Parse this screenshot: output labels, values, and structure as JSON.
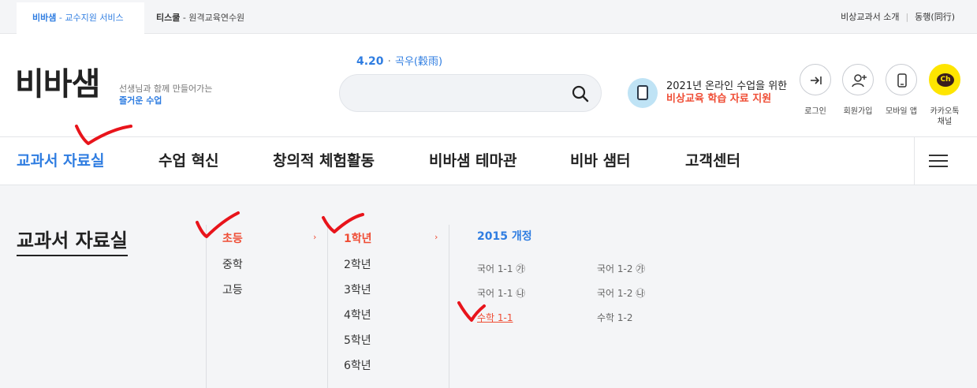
{
  "topbar": {
    "site_tabs": [
      {
        "name": "비바샘",
        "sub": "- 교수지원 서비스"
      },
      {
        "name": "티스쿨",
        "sub": "- 원격교육연수원"
      }
    ],
    "links": [
      "비상교과서 소개",
      "동행(同行)"
    ]
  },
  "header": {
    "logo": "비바샘",
    "tagline_line1": "선생님과 함께 만들어가는",
    "tagline_line2": "즐거운 수업",
    "date": "4.20",
    "solar_term": "곡우(穀雨)",
    "search_value": "",
    "promo_line1": "2021년 온라인 수업을 위한",
    "promo_line2": "비상교육 학습 자료 지원"
  },
  "utility": [
    {
      "label": "로그인",
      "icon": "login-icon"
    },
    {
      "label": "회원가입",
      "icon": "add-user-icon"
    },
    {
      "label": "모바일 앱",
      "icon": "mobile-icon"
    },
    {
      "label_line1": "카카오톡",
      "label_line2": "채널",
      "icon": "kakao-channel-icon",
      "badge": "Ch"
    }
  ],
  "gnb": [
    "교과서 자료실",
    "수업 혁신",
    "창의적 체험활동",
    "비바샘 테마관",
    "비바 샘터",
    "고객센터"
  ],
  "panel": {
    "title": "교과서 자료실",
    "levels": [
      "초등",
      "중학",
      "고등"
    ],
    "grades": [
      "1학년",
      "2학년",
      "3학년",
      "4학년",
      "5학년",
      "6학년"
    ],
    "curriculum": "2015 개정",
    "books": [
      "국어 1-1 ㉮",
      "국어 1-2 ㉮",
      "국어 1-1 ㉯",
      "국어 1-2 ㉯",
      "수학 1-1",
      "수학 1-2"
    ]
  },
  "colors": {
    "accent": "#2f7de1",
    "highlight": "#ef4d35",
    "annotation": "#e8141b",
    "kakao": "#fee500"
  }
}
